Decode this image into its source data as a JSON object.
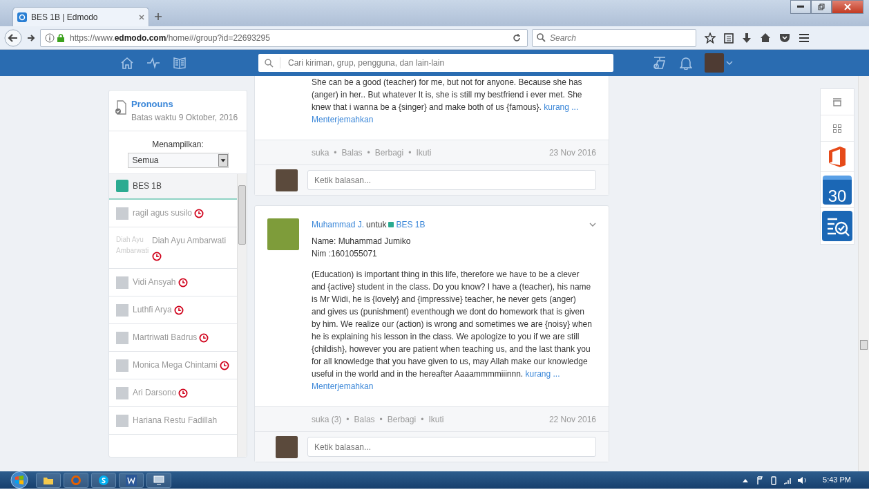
{
  "browser": {
    "tab_title": "BES 1B | Edmodo",
    "url_prefix": "https://www.",
    "url_domain": "edmodo.com",
    "url_path": "/home#/group?id=22693295",
    "search_placeholder": "Search"
  },
  "header": {
    "search_placeholder": "Cari kiriman, grup, pengguna, dan lain-lain"
  },
  "assignment": {
    "title": "Pronouns",
    "due": "Batas waktu 9 Oktober, 2016"
  },
  "filter": {
    "label": "Menampilkan:",
    "value": "Semua"
  },
  "group": {
    "name": "BES 1B",
    "color": "#2bab91",
    "selected": true
  },
  "students": [
    {
      "name": "ragil agus susilo",
      "late": true
    },
    {
      "name": "Diah Ayu Ambarwati",
      "avatar_alt": "Diah Ayu Ambarwati",
      "late": true
    },
    {
      "name": "Vidi Ansyah",
      "late": true
    },
    {
      "name": "Luthfi Arya",
      "late": true
    },
    {
      "name": "Martriwati Badrus",
      "late": true
    },
    {
      "name": "Monica Mega Chintami",
      "late": true
    },
    {
      "name": "Ari Darsono",
      "late": true
    },
    {
      "name": "Hariana Restu Fadillah",
      "late": false
    }
  ],
  "posts": [
    {
      "body": "She can be a good (teacher) for me, but not for anyone. Because she has (anger) in her.. But whatever It is, she is still my bestfriend i ever met. She knew that i wanna be a {singer} and make both of us {famous}.",
      "less": "kurang ...",
      "translate": "Menterjemahkan",
      "actions": [
        "suka",
        "Balas",
        "Berbagi",
        "Ikuti"
      ],
      "separator": "•",
      "date": "23 Nov 2016",
      "reply_placeholder": "Ketik balasan..."
    },
    {
      "author": "Muhammad J.",
      "connector": "untuk",
      "group": "BES 1B",
      "intro": [
        "Name: Muhammad Jumiko",
        "Nim :1601055071"
      ],
      "body": "(Education) is important thing in this life, therefore we have to be a clever and {active} student in the class. Do you know? I have a (teacher), his name is Mr Widi, he is {lovely} and {impressive} teacher, he never gets (anger) and gives us (punishment) eventhough we dont do homework that is given by him. We realize our (action) is wrong and sometimes we are {noisy} when he is explaining his lesson in the class. We apologize to you if we are still {childish}, however you are patient when teaching us, and the last thank you for all knowledge that you have given to us, may Allah make our knowledge useful in the world and in the hereafter Aaaammmmiiinnn.",
      "less": "kurang ...",
      "translate": "Menterjemahkan",
      "actions": [
        "suka (3)",
        "Balas",
        "Berbagi",
        "Ikuti"
      ],
      "separator": "•",
      "date": "22 Nov 2016",
      "reply_placeholder": "Ketik balasan..."
    }
  ],
  "rail": {
    "calendar_day": "30"
  },
  "taskbar": {
    "time": "5:43 PM"
  }
}
